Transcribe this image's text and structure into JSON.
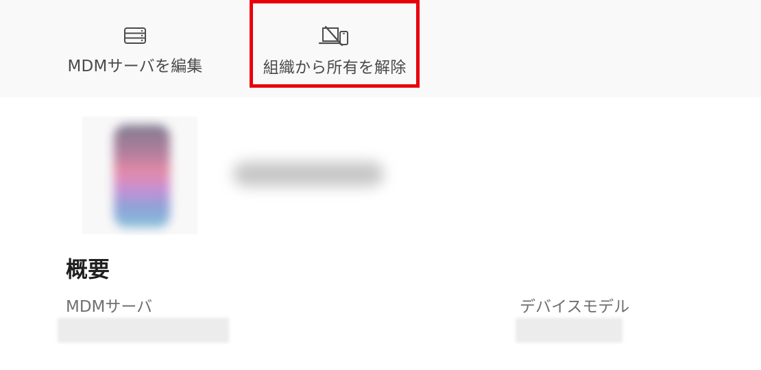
{
  "toolbar": {
    "edit_server_label": "MDMサーバを編集",
    "release_label": "組織から所有を解除"
  },
  "overview": {
    "title": "概要",
    "mdm_server_label": "MDMサーバ",
    "mdm_server_value": "",
    "device_model_label": "デバイスモデル",
    "device_model_value": ""
  },
  "device": {
    "name": ""
  },
  "colors": {
    "highlight": "#e8000b",
    "toolbar_background": "#f9f9f9"
  },
  "icons": {
    "edit_server": "server-icon",
    "release": "laptop-phone-slash-icon"
  }
}
